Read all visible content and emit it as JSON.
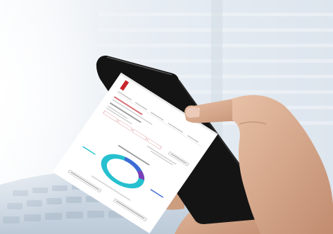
{
  "scene": {
    "subject": "hand-holding-smartphone",
    "background_color": "#e9eef4",
    "phone_body_color": "#141414",
    "hand_color": "#d5a98d"
  },
  "phone_screen": {
    "brand_color": "#c8262c",
    "donut_colors": [
      "#26c0cf",
      "#3d6bd6",
      "#7b3fb8",
      "#26c0cf"
    ],
    "icons": [
      "brand-logo-icon",
      "donut-chart-icon"
    ]
  }
}
